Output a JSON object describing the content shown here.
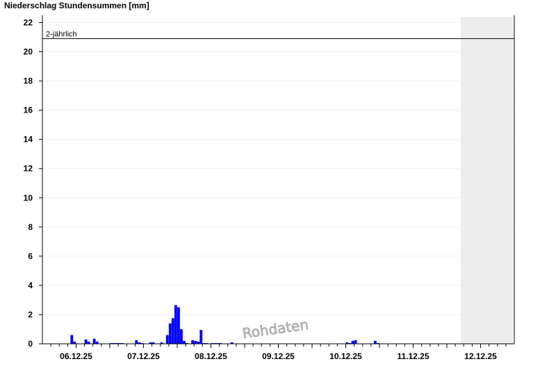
{
  "title": "Niederschlag Stundensummen [mm]",
  "watermark": "Rohdaten",
  "colors": {
    "bar": "#0000ff",
    "forecast_shade": "#ececec",
    "grid": "#f0f0f0",
    "axis": "#000000"
  },
  "chart_data": {
    "type": "bar",
    "title": "Niederschlag Stundensummen [mm]",
    "xlabel": "",
    "ylabel": "",
    "ylim": [
      0,
      22.5
    ],
    "yticks": [
      0,
      2,
      4,
      6,
      8,
      10,
      12,
      14,
      16,
      18,
      20,
      22
    ],
    "xlim": [
      0,
      168
    ],
    "xticks": [
      {
        "t": 12,
        "label": "06.12.25"
      },
      {
        "t": 36,
        "label": "07.12.25"
      },
      {
        "t": 60,
        "label": "08.12.25"
      },
      {
        "t": 84,
        "label": "09.12.25"
      },
      {
        "t": 108,
        "label": "10.12.25"
      },
      {
        "t": 132,
        "label": "11.12.25"
      },
      {
        "t": 156,
        "label": "12.12.25"
      }
    ],
    "grid": true,
    "reference_lines": [
      {
        "label": "2-jährlich",
        "value": 20.9
      }
    ],
    "shaded_region": {
      "from": 149,
      "to": 168
    },
    "series": [
      {
        "t": [
          10,
          11,
          15,
          16,
          18,
          19,
          24,
          25,
          26,
          27,
          28,
          33,
          34,
          35,
          38,
          39,
          42,
          44,
          45,
          46,
          47,
          48,
          49,
          50,
          51,
          53,
          54,
          55,
          56,
          57,
          58,
          60,
          61,
          62,
          63,
          67,
          108,
          109,
          110,
          111,
          118,
          119
        ],
        "values": [
          0.6,
          0.15,
          0.3,
          0.15,
          0.35,
          0.15,
          0.05,
          0.05,
          0.05,
          0.05,
          0.05,
          0.25,
          0.1,
          0.05,
          0.1,
          0.1,
          0.1,
          0.6,
          1.4,
          1.75,
          2.65,
          2.5,
          1.0,
          0.2,
          0.05,
          0.25,
          0.2,
          0.15,
          0.95,
          0.05,
          0.05,
          0.05,
          0.05,
          0.05,
          0.05,
          0.1,
          0.1,
          0.05,
          0.2,
          0.25,
          0.2,
          0.05
        ]
      }
    ]
  }
}
